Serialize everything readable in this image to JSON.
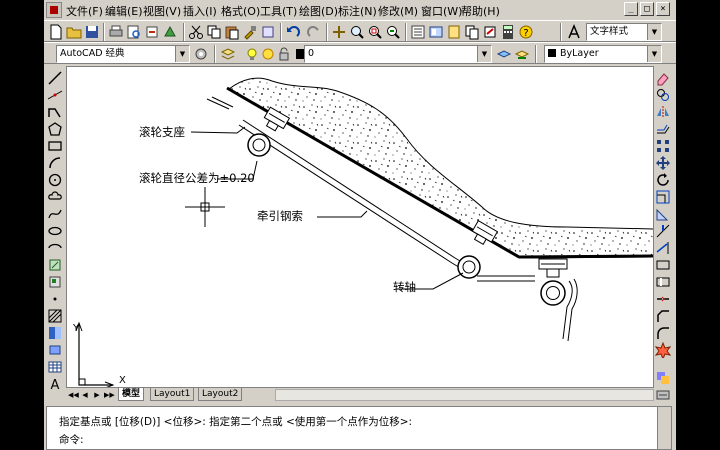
{
  "menubar": {
    "items": [
      "文件(F)",
      "编辑(E)",
      "视图(V)",
      "插入(I)",
      "格式(O)",
      "工具(T)",
      "绘图(D)",
      "标注(N)",
      "修改(M)",
      "窗口(W)",
      "帮助(H)"
    ],
    "window_controls": [
      "_",
      "□",
      "×"
    ]
  },
  "toolbar1": {
    "text_style": "文字样式"
  },
  "toolbar2": {
    "workspace": "AutoCAD 经典",
    "layer": "0",
    "color": "ByLayer"
  },
  "drawing": {
    "labels": [
      "滚轮支座",
      "滚轮直径公差为±0.20",
      "牵引钢索",
      "转轴"
    ],
    "ucs_x": "X",
    "ucs_y": "Y"
  },
  "tabs": {
    "nav": [
      "◀◀",
      "◀",
      "▶",
      "▶▶"
    ],
    "items": [
      "模型",
      "Layout1",
      "Layout2"
    ]
  },
  "command": {
    "line1": "指定基点或 [位移(D)] <位移>:  指定第二个点或 <使用第一个点作为位移>:",
    "line2": "命令:"
  },
  "colors": {
    "background": "#d4d0c8",
    "canvas": "#ffffff",
    "layer_swatch": "#000000"
  }
}
